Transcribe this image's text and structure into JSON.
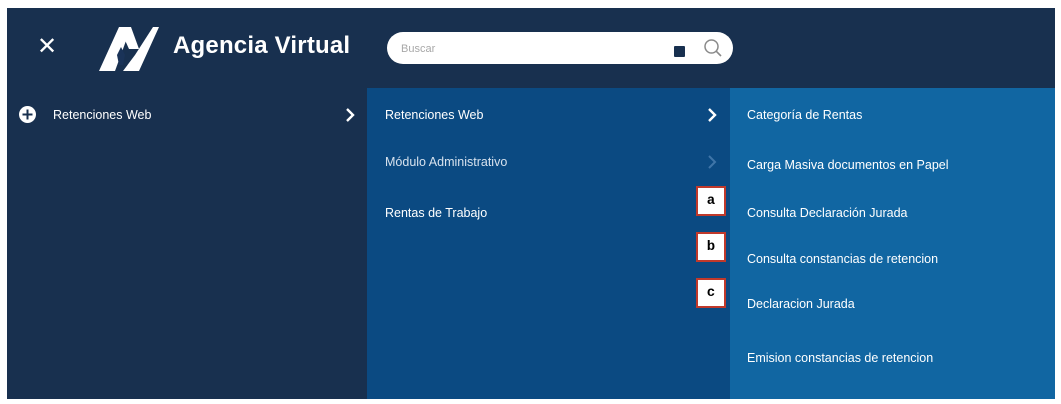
{
  "header": {
    "title": "Agencia Virtual",
    "search_placeholder": "Buscar",
    "search_value": ""
  },
  "icons": {
    "close": "close-icon",
    "logo": "agencia-virtual-logo",
    "search": "search-icon",
    "home": "home-icon",
    "windows": "window-icon",
    "add": "plus-circle-icon",
    "chevron": "chevron-right-icon"
  },
  "colors": {
    "header_bg": "#18304f",
    "column1_bg": "#18304f",
    "column2_bg": "#0b4a82",
    "column3_bg": "#1166a2",
    "marker_border": "#c0392b"
  },
  "menu": {
    "level1": [
      {
        "label": "Retenciones Web"
      }
    ],
    "level2": [
      {
        "label": "Retenciones Web"
      },
      {
        "label": "Módulo Administrativo"
      },
      {
        "label": "Rentas de Trabajo"
      }
    ],
    "level3": [
      {
        "label": "Categoría de Rentas"
      },
      {
        "label": "Carga Masiva documentos en Papel"
      },
      {
        "label": "Consulta Declaración Jurada"
      },
      {
        "label": "Consulta constancias de retencion"
      },
      {
        "label": "Declaracion Jurada"
      },
      {
        "label": "Emision constancias de retencion"
      }
    ]
  },
  "markers": [
    "a",
    "b",
    "c"
  ]
}
